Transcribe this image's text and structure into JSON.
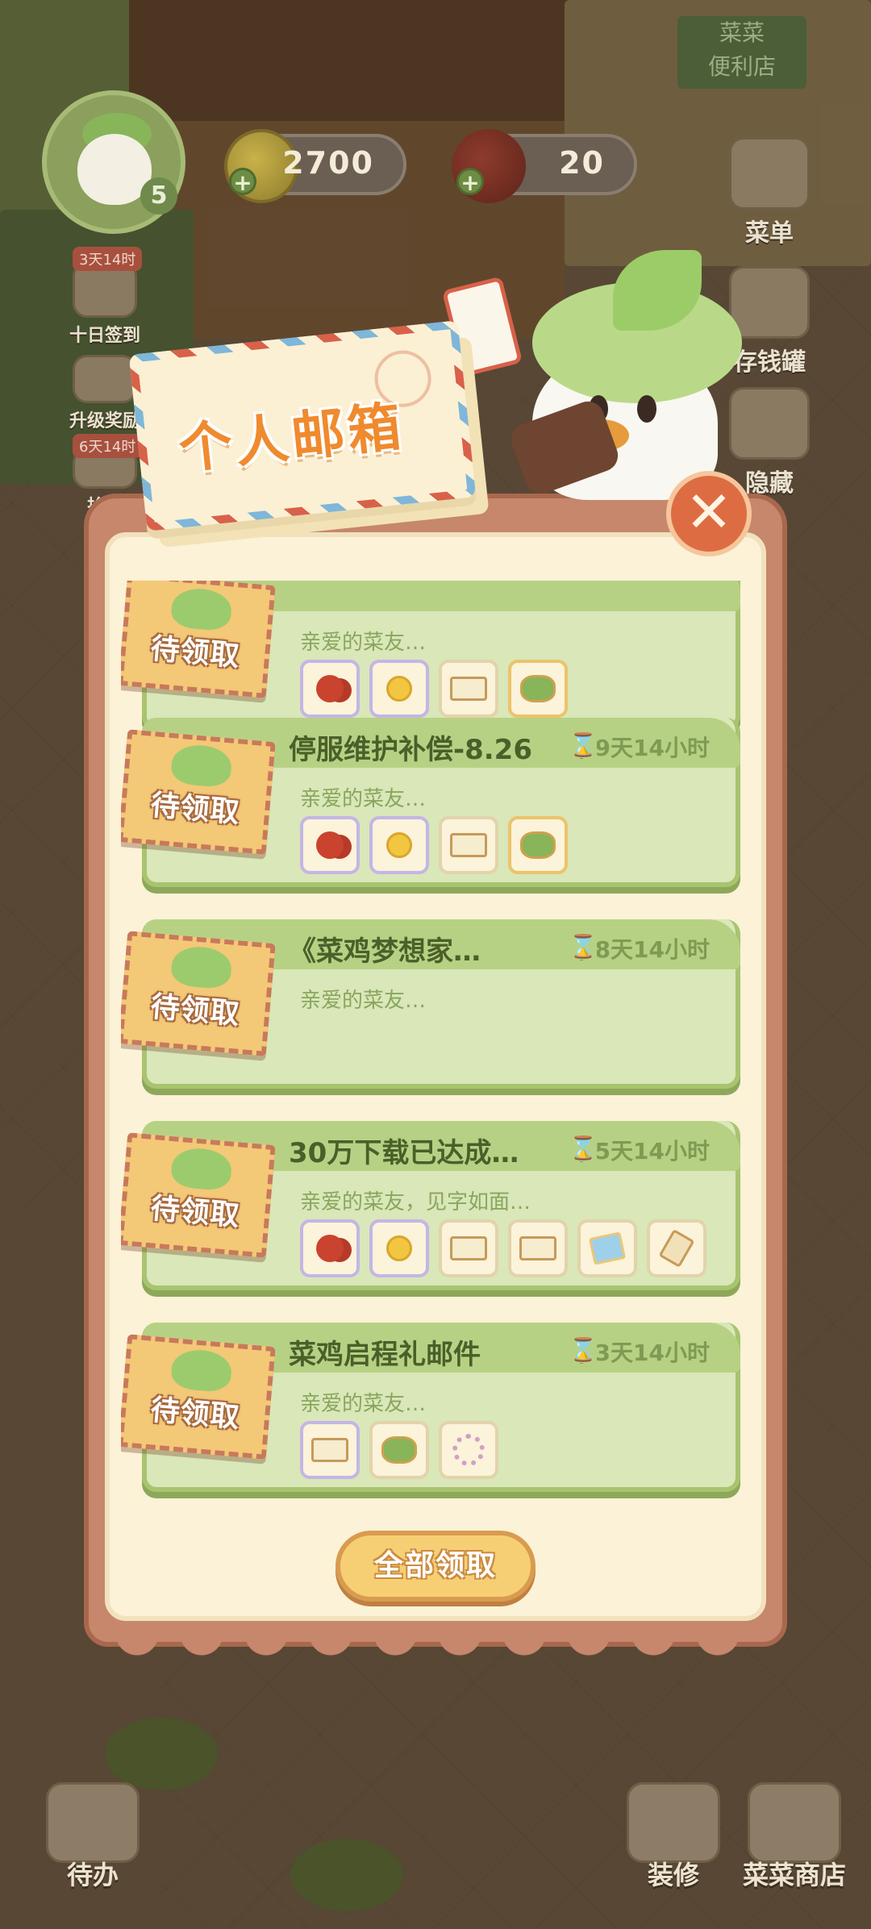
{
  "hud": {
    "level": "5",
    "coins": "2700",
    "cherries": "20"
  },
  "side_left": [
    {
      "tag": "3天14时",
      "label": "十日签到"
    },
    {
      "tag": "",
      "label": "升级奖励"
    },
    {
      "tag": "6天14时",
      "label": "拾荒"
    }
  ],
  "side_right": [
    {
      "label": "菜单"
    },
    {
      "label": "存钱罐"
    },
    {
      "label": "隐藏"
    }
  ],
  "mailbox": {
    "title": "个人邮箱",
    "close_label": "✕",
    "claim_all_label": "全部领取"
  },
  "mails": [
    {
      "title": "",
      "timer": "",
      "preview": "亲爱的菜友…",
      "state": "待领取",
      "rewards": [
        {
          "icon": "cherry",
          "frame": "purple"
        },
        {
          "icon": "coin",
          "frame": "purple"
        },
        {
          "icon": "ticket",
          "frame": "plain"
        },
        {
          "icon": "plant",
          "frame": "gold"
        }
      ]
    },
    {
      "title": "停服维护补偿-8.26",
      "timer": "9天14小时",
      "preview": "亲爱的菜友…",
      "state": "待领取",
      "rewards": [
        {
          "icon": "cherry",
          "frame": "purple"
        },
        {
          "icon": "coin",
          "frame": "purple"
        },
        {
          "icon": "ticket",
          "frame": "plain"
        },
        {
          "icon": "plant",
          "frame": "gold"
        }
      ]
    },
    {
      "title": "《菜鸡梦想家…",
      "timer": "8天14小时",
      "preview": "亲爱的菜友…",
      "state": "待领取",
      "rewards": []
    },
    {
      "title": "30万下载已达成…",
      "timer": "5天14小时",
      "preview": "亲爱的菜友，见字如面…",
      "state": "待领取",
      "rewards": [
        {
          "icon": "cherry",
          "frame": "purple"
        },
        {
          "icon": "coin",
          "frame": "purple"
        },
        {
          "icon": "ticket",
          "frame": "plain"
        },
        {
          "icon": "ticket",
          "frame": "plain"
        },
        {
          "icon": "card",
          "frame": "plain"
        },
        {
          "icon": "scroll",
          "frame": "plain"
        }
      ]
    },
    {
      "title": "菜鸡启程礼邮件",
      "timer": "3天14小时",
      "preview": "亲爱的菜友…",
      "state": "待领取",
      "rewards": [
        {
          "icon": "ticket",
          "frame": "purple"
        },
        {
          "icon": "plant",
          "frame": "plain"
        },
        {
          "icon": "wreath",
          "frame": "plain"
        }
      ]
    }
  ],
  "bottom": {
    "todo_label": "待办",
    "decorate_label": "装修",
    "shop_label": "菜菜商店"
  }
}
